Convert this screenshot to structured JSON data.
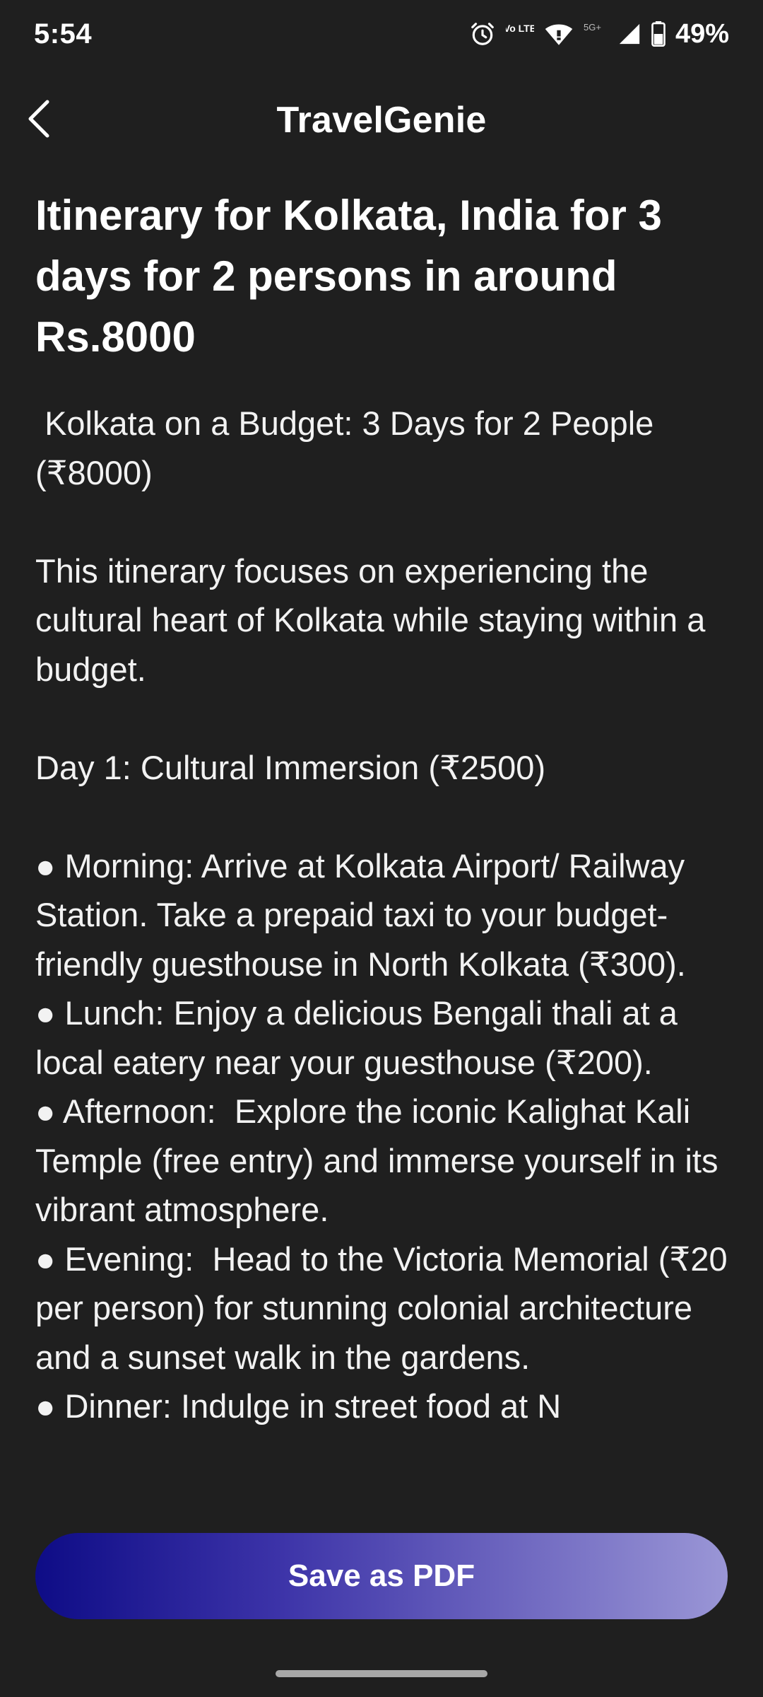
{
  "status_bar": {
    "time": "5:54",
    "network_label": "5G+",
    "volte_label": "Vo LTE",
    "battery_percent": "49%"
  },
  "app_bar": {
    "title": "TravelGenie"
  },
  "itinerary": {
    "heading": "Itinerary for Kolkata, India for 3 days for 2 persons in around Rs.8000",
    "body": " Kolkata on a Budget: 3 Days for 2 People (₹8000)\n\nThis itinerary focuses on experiencing the cultural heart of Kolkata while staying within a budget.\n\nDay 1: Cultural Immersion (₹2500)\n\n● Morning: Arrive at Kolkata Airport/ Railway Station. Take a prepaid taxi to your budget-friendly guesthouse in North Kolkata (₹300).\n● Lunch: Enjoy a delicious Bengali thali at a local eatery near your guesthouse (₹200).\n● Afternoon:  Explore the iconic Kalighat Kali Temple (free entry) and immerse yourself in its vibrant atmosphere.\n● Evening:  Head to the Victoria Memorial (₹20 per person) for stunning colonial architecture and a sunset walk in the gardens.\n● Dinner: Indulge in street food at N"
  },
  "actions": {
    "save_pdf_label": "Save as PDF"
  }
}
